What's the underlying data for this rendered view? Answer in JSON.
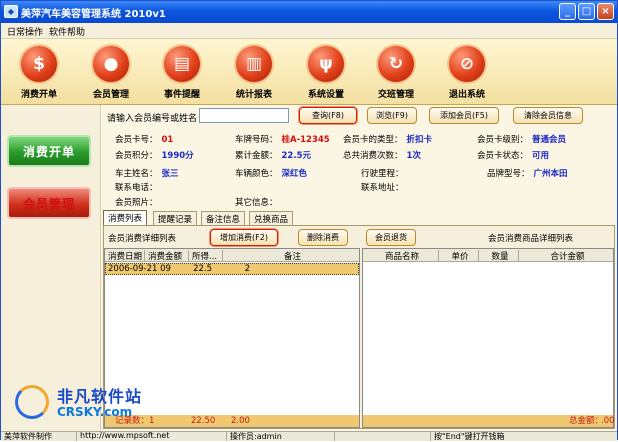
{
  "window": {
    "title": "美萍汽车美容管理系统 2010v1",
    "app_icon": "app-icon"
  },
  "menubar": {
    "items": [
      "日常操作",
      "软件帮助"
    ]
  },
  "toolbar": {
    "items": [
      {
        "label": "消费开单",
        "icon": "dollar-icon",
        "glyph": "$"
      },
      {
        "label": "会员管理",
        "icon": "member-icon",
        "glyph": "●"
      },
      {
        "label": "事件提醒",
        "icon": "book-icon",
        "glyph": "▤"
      },
      {
        "label": "统计报表",
        "icon": "bar-chart-icon",
        "glyph": "▥"
      },
      {
        "label": "系统设置",
        "icon": "tools-icon",
        "glyph": "ψ"
      },
      {
        "label": "交班管理",
        "icon": "refresh-icon",
        "glyph": "↻"
      },
      {
        "label": "退出系统",
        "icon": "exit-icon",
        "glyph": "⊘"
      }
    ]
  },
  "sidebar": {
    "items": [
      "消费开单",
      "会员管理"
    ]
  },
  "search": {
    "label": "请输入会员编号或姓名",
    "value": "",
    "buttons": [
      "查询(F8)",
      "浏览(F9)",
      "添加会员(F5)",
      "清除会员信息"
    ]
  },
  "member": {
    "card_no_label": "会员卡号：",
    "card_no": "01",
    "plate_label": "车牌号码：",
    "plate": "桂A-12345",
    "card_type_label": "会员卡的类型：",
    "card_type": "折扣卡",
    "card_level_label": "会员卡级别：",
    "card_level": "普通会员",
    "points_label": "会员积分：",
    "points": "1990分",
    "total_amount_label": "累计金额：",
    "total_amount": "22.5元",
    "visits_label": "总共消费次数：",
    "visits": "1次",
    "status_label": "会员卡状态：",
    "status": "可用",
    "owner_label": "车主姓名：",
    "owner": "张三",
    "car_color_label": "车辆颜色：",
    "car_color": "深红色",
    "mileage_label": "行驶里程：",
    "mileage": "",
    "brand_label": "品牌型号：",
    "brand": "广州本田",
    "phone_label": "联系电话：",
    "phone": "",
    "address_label": "联系地址：",
    "address": "",
    "photo_label": "会员照片：",
    "other_label": "其它信息：",
    "other": ""
  },
  "tabs": [
    "消费列表",
    "提醒记录",
    "备注信息",
    "兑换商品"
  ],
  "consumption": {
    "left_title": "会员消费详细列表",
    "buttons": [
      "增加消费(F2)",
      "删除消费",
      "会员退货"
    ],
    "right_title": "会员消费商品详细列表",
    "left_columns": [
      "消费日期",
      "消费金额",
      "所得...",
      "备注"
    ],
    "left_rows": [
      [
        "2006-09-21 09",
        "22.5",
        "2",
        ""
      ]
    ],
    "left_footer": {
      "label": "记录数：",
      "count": "1",
      "amount": "22.50",
      "points": "2.00"
    },
    "right_columns": [
      "商品名称",
      "单价",
      "数量",
      "合计金额"
    ],
    "right_rows": [],
    "right_footer": {
      "label": "总金额：",
      "value": ".00"
    }
  },
  "statusbar": {
    "items": [
      "美萍软件制作",
      "http://www.mpsoft.net",
      "操作员:admin",
      "",
      "按\"End\"键打开钱箱"
    ]
  },
  "watermark": {
    "cn": "非凡软件站",
    "en": "CRSKY.com"
  },
  "colors": {
    "title_bar": "#0c56e0",
    "accent_red": "#d01010",
    "accent_blue": "#1a28c8",
    "row_highlight": "#f0c870"
  }
}
